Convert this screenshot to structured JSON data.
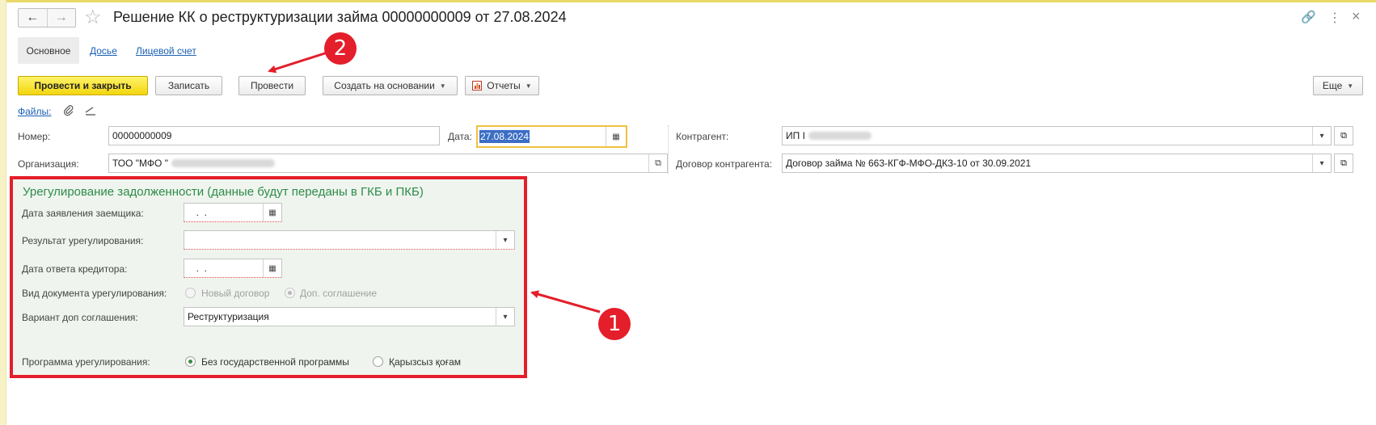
{
  "window": {
    "title": "Решение КК о реструктуризации займа 00000000009 от 27.08.2024"
  },
  "nav": {
    "back_icon": "←",
    "forward_icon": "→",
    "star_icon": "☆"
  },
  "top_icons": {
    "link": "🔗",
    "more": "⋮",
    "close": "×"
  },
  "tabs": [
    {
      "label": "Основное",
      "active": true
    },
    {
      "label": "Досье"
    },
    {
      "label": "Лицевой счет"
    }
  ],
  "toolbar": {
    "post_close": "Провести и закрыть",
    "save": "Записать",
    "post": "Провести",
    "create_based": "Создать на основании",
    "reports": "Отчеты",
    "more": "Еще"
  },
  "files": {
    "label": "Файлы:"
  },
  "form": {
    "number_label": "Номер:",
    "number_value": "00000000009",
    "date_label": "Дата:",
    "date_value": "27.08.2024",
    "org_label": "Организация:",
    "org_value": "ТОО \"МФО \"",
    "counterparty_label": "Контрагент:",
    "counterparty_value": "ИП I",
    "contract_label": "Договор контрагента:",
    "contract_value": "Договор займа № 663-КГФ-МФО-ДКЗ-10 от 30.09.2021"
  },
  "panel": {
    "title": "Урегулирование задолженности (данные будут переданы в ГКБ и ПКБ)",
    "app_date_label": "Дата заявления заемщика:",
    "app_date_value": "  .  .",
    "result_label": "Результат урегулирования:",
    "result_value": "",
    "reply_date_label": "Дата ответа кредитора:",
    "reply_date_value": "  .  .",
    "doc_type_label": "Вид документа урегулирования:",
    "doc_type_opt1": "Новый договор",
    "doc_type_opt2": "Доп. соглашение",
    "variant_label": "Вариант доп соглашения:",
    "variant_value": "Реструктуризация",
    "program_label": "Программа урегулирования:",
    "program_opt1": "Без государственной программы",
    "program_opt2": "Қарызсыз қоғам"
  },
  "annotations": {
    "badge1": "1",
    "badge2": "2"
  },
  "colors": {
    "highlight": "#e41e2a",
    "primary_button": "#f2d60f",
    "link": "#1a5fb4",
    "panel_bg": "#eff5ee"
  }
}
